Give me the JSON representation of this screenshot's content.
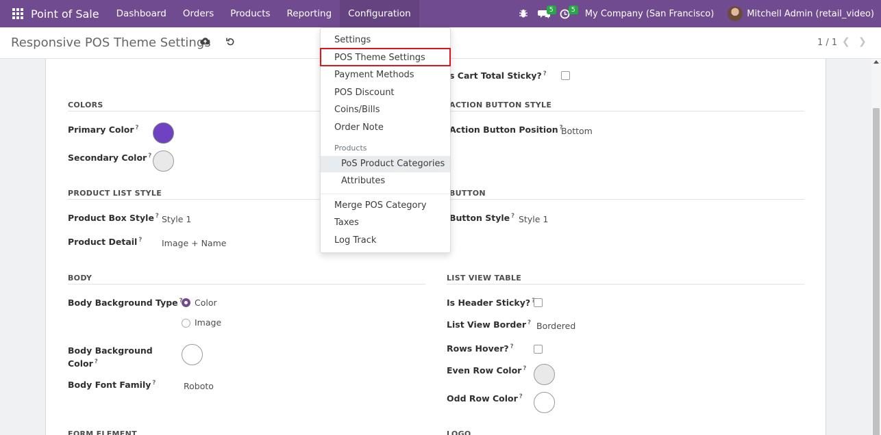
{
  "navbar": {
    "app_icon": "grid-icon",
    "brand": "Point of Sale",
    "menu": [
      "Dashboard",
      "Orders",
      "Products",
      "Reporting",
      "Configuration"
    ],
    "active_menu": "Configuration",
    "bug_icon": "bug-icon",
    "messages_icon": "chat-icon",
    "messages_count": "5",
    "activity_icon": "clock-icon",
    "activity_count": "5",
    "company": "My Company (San Francisco)",
    "user": "Mitchell Admin (retail_video)"
  },
  "control": {
    "title": "Responsive POS Theme Settings",
    "save_icon": "cloud-upload-icon",
    "discard_icon": "undo-icon",
    "pager": "1 / 1"
  },
  "dropdown": {
    "items": [
      "Settings",
      "POS Theme Settings",
      "Payment Methods",
      "POS Discount",
      "Coins/Bills",
      "Order Note"
    ],
    "products_header": "Products",
    "product_items": [
      "PoS Product Categories",
      "Attributes"
    ],
    "more_items": [
      "Merge POS Category",
      "Taxes",
      "Log Track"
    ],
    "highlighted": "POS Theme Settings"
  },
  "form": {
    "left": {
      "colors_title": "COLORS",
      "primary_color_label": "Primary Color",
      "primary_color_value": "#6f42c1",
      "secondary_color_label": "Secondary Color",
      "secondary_color_value": "#e9e9e9",
      "product_list_title": "PRODUCT LIST STYLE",
      "product_box_style_label": "Product Box Style",
      "product_box_style_value": "Style 1",
      "product_detail_label": "Product Detail",
      "product_detail_value": "Image + Name",
      "body_title": "BODY",
      "body_bg_type_label": "Body Background Type",
      "body_bg_type_options": [
        "Color",
        "Image"
      ],
      "body_bg_type_selected": "Color",
      "body_bg_color_label_1": "Body Background",
      "body_bg_color_label_2": "Color",
      "body_bg_color_value": "#ffffff",
      "body_font_label": "Body Font Family",
      "body_font_value": "Roboto",
      "form_element_title": "FORM ELEMENT"
    },
    "right": {
      "cart_total_sticky_label": "s Cart Total Sticky?",
      "cart_total_sticky_checked": false,
      "action_button_title": "ACTION BUTTON STYLE",
      "action_button_position_label": "Action Button Position",
      "action_button_position_value": "Bottom",
      "button_title": "BUTTON",
      "button_style_label": "Button Style",
      "button_style_value": "Style 1",
      "list_view_title": "LIST VIEW TABLE",
      "header_sticky_label": "Is Header Sticky?",
      "header_sticky_checked": false,
      "list_view_border_label": "List View Border",
      "list_view_border_value": "Bordered",
      "rows_hover_label": "Rows Hover?",
      "rows_hover_checked": false,
      "even_row_color_label": "Even Row Color",
      "even_row_color_value": "#e9e9e9",
      "odd_row_color_label": "Odd Row Color",
      "odd_row_color_value": "#ffffff",
      "logo_title": "LOGO"
    },
    "help_mark": "?"
  }
}
